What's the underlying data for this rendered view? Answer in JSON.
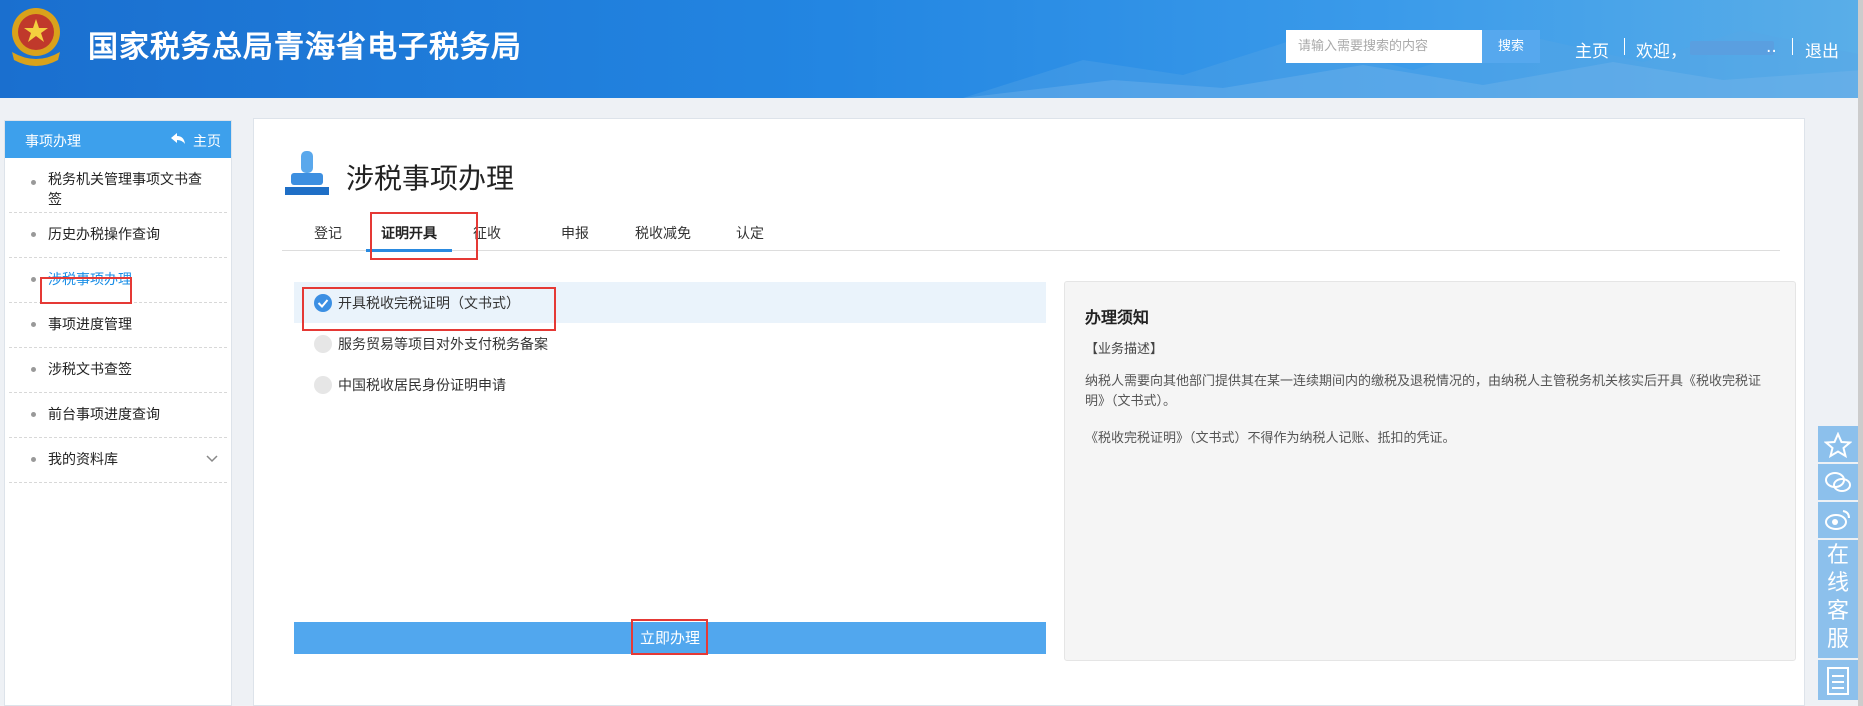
{
  "header": {
    "site_title": "国家税务总局青海省电子税务局",
    "search_placeholder": "请输入需要搜索的内容",
    "search_button": "搜索",
    "nav_home": "主页",
    "welcome": "欢迎，",
    "welcome_suffix": "..",
    "logout": "退出"
  },
  "sidebar": {
    "title": "事项办理",
    "home_label": "主页",
    "items": [
      {
        "label": "税务机关管理事项文书查",
        "label2": "签"
      },
      {
        "label": "历史办税操作查询"
      },
      {
        "label": "涉税事项办理"
      },
      {
        "label": "事项进度管理"
      },
      {
        "label": "涉税文书查签"
      },
      {
        "label": "前台事项进度查询"
      },
      {
        "label": "我的资料库"
      }
    ]
  },
  "main": {
    "page_title": "涉税事项办理",
    "tabs": [
      "登记",
      "证明开具",
      "征收",
      "申报",
      "税收减免",
      "认定"
    ],
    "active_tab": "证明开具",
    "options": [
      {
        "label": "开具税收完税证明（文书式）",
        "checked": true
      },
      {
        "label": "服务贸易等项目对外支付税务备案",
        "checked": false
      },
      {
        "label": "中国税收居民身份证明申请",
        "checked": false
      }
    ],
    "submit_button": "立即办理",
    "notice": {
      "title": "办理须知",
      "tag": "【业务描述】",
      "para1": "纳税人需要向其他部门提供其在某一连续期间内的缴税及退税情况的，由纳税人主管税务机关核实后开具《税收完税证明》（文书式）。",
      "para2": "《税收完税证明》（文书式）不得作为纳税人记账、抵扣的凭证。"
    }
  },
  "floatbar": {
    "service_text": "在线客服",
    "icons": [
      "star-icon",
      "wechat-icon",
      "weibo-icon",
      "document-icon"
    ]
  },
  "colors": {
    "header": "#2386e2",
    "accent": "#3da0ec",
    "button": "#51a7ee",
    "highlight": "#e53935"
  }
}
